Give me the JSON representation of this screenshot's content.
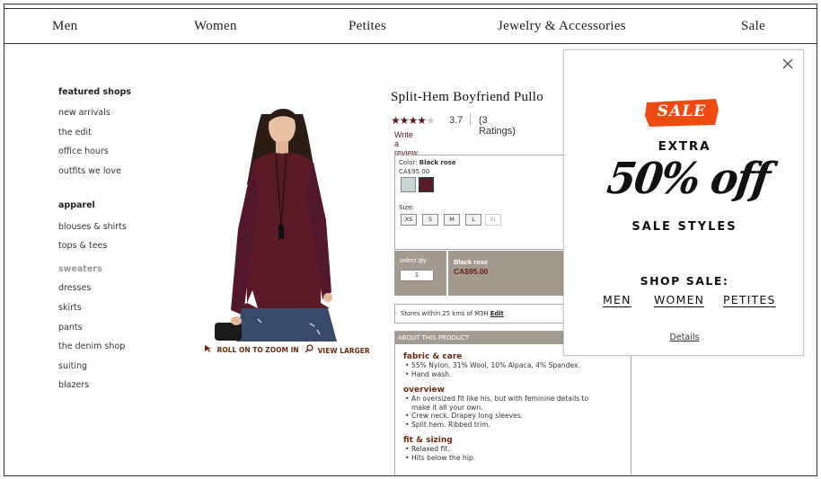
{
  "nav": {
    "men": "Men",
    "women": "Women",
    "petites": "Petites",
    "jewelry": "Jewelry & Accessories",
    "sale": "Sale"
  },
  "sidebar": {
    "featured_head": "featured shops",
    "new_arrivals": "new arrivals",
    "the_edit": "the edit",
    "office_hours": "office hours",
    "outfits": "outfits we love",
    "apparel_head": "apparel",
    "blouses": "blouses & shirts",
    "tops": "tops & tees",
    "sweaters": "sweaters",
    "dresses": "dresses",
    "skirts": "skirts",
    "pants": "pants",
    "denim": "the denim shop",
    "suiting": "suiting",
    "blazers": "blazers"
  },
  "image_links": {
    "zoom": "ROLL ON TO ZOOM IN",
    "larger": "VIEW LARGER"
  },
  "product": {
    "title": "Split-Hem Boyfriend Pullo",
    "stars": 3.7,
    "rating": "3.7",
    "rating_count": "(3 Ratings)",
    "write_review": "Write a review",
    "color_label": "Color:",
    "color_value": "Black rose",
    "price": "CA$95.00",
    "size_label": "Size:",
    "sizes": [
      "XS",
      "S",
      "M",
      "L",
      "XL"
    ],
    "qty_label": "select qty",
    "qty_value": "1",
    "buy_color": "Black rose",
    "buy_price": "CA$95.00",
    "stores_text": "Stores within 25 kms of M3H",
    "stores_edit": "Edit"
  },
  "about": {
    "header": "ABOUT THIS PRODUCT",
    "fabric_head": "fabric & care",
    "fabric_1": "55% Nylon, 31% Wool, 10% Alpaca, 4% Spandex.",
    "fabric_2": "Hand wash.",
    "overview_head": "overview",
    "overview_1a": "An oversized fit like his, but with feminine details to",
    "overview_1b": "make it all your own.",
    "overview_2": "Crew neck. Drapey long sleeves.",
    "overview_3": "Split hem. Ribbed trim.",
    "fit_head": "fit & sizing",
    "fit_1": "Relaxed fit.",
    "fit_2": "Hits below the hip."
  },
  "popup": {
    "badge": "SALE",
    "extra": "EXTRA",
    "big": "50% off",
    "styles": "SALE STYLES",
    "shop_sale": "SHOP SALE:",
    "men": "MEN",
    "women": "WOMEN",
    "petites": "PETITES",
    "details": "Details"
  },
  "colors": {
    "accent": "#6b1e1e",
    "sweater": "#5a1a26",
    "badge": "#ee4b10",
    "bar": "#a39a90"
  }
}
